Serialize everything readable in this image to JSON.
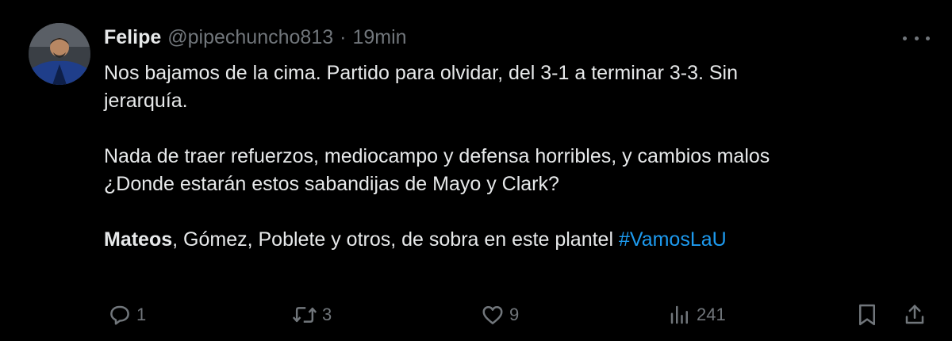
{
  "tweet": {
    "author_name": "Felipe",
    "handle": "@pipechuncho813",
    "separator": "·",
    "time": "19min",
    "lines": [
      "Nos bajamos de la cima. Partido para olvidar, del 3-1 a terminar 3-3. Sin",
      "jerarquía.",
      "Nada de traer refuerzos, mediocampo y defensa horribles, y cambios malos",
      "¿Donde estarán estos sabandijas de Mayo y Clark?"
    ],
    "last_line": {
      "bold_name": "Mateos",
      "text": ", Gómez, Poblete y otros, de sobra en este plantel ",
      "hashtag": "#VamosLaU"
    }
  },
  "actions": {
    "replies": "1",
    "reposts": "3",
    "likes": "9",
    "views": "241"
  },
  "icons": {
    "more": "more-horizontal-icon",
    "reply": "reply-bubble-icon",
    "repost": "repost-arrows-icon",
    "like": "heart-icon",
    "views": "bar-chart-icon",
    "bookmark": "bookmark-icon",
    "share": "share-upload-icon"
  },
  "colors": {
    "background": "#000000",
    "text": "#e7e9ea",
    "muted": "#71767b",
    "link": "#1d9bf0"
  }
}
